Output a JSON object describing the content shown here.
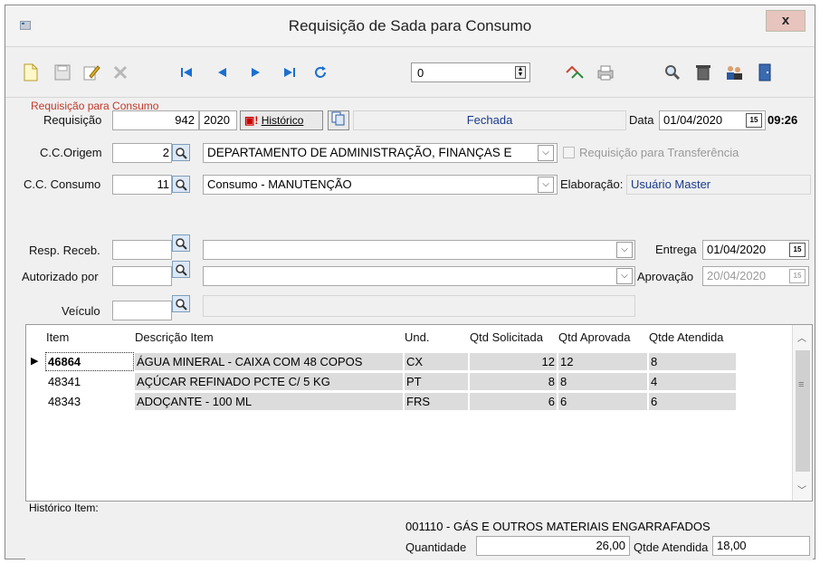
{
  "window": {
    "title": "Requisição de Sada para Consumo",
    "close": "x"
  },
  "toolbar": {
    "icons": [
      "new-document-icon",
      "save-icon",
      "edit-icon",
      "cancel-icon",
      "first-record-icon",
      "previous-record-icon",
      "next-record-icon",
      "last-record-icon",
      "refresh-icon",
      "transfer-icon",
      "print-icon",
      "search-icon",
      "delete-icon",
      "users-icon",
      "exit-icon"
    ],
    "record_value": "0"
  },
  "header": {
    "section_title": "Requisição para Consumo",
    "requisicao_label": "Requisição",
    "requisicao_number": "942",
    "requisicao_year": "2020",
    "historico_button": "Histórico",
    "status": "Fechada",
    "data_label": "Data",
    "data_value": "01/04/2020",
    "time": "09:26"
  },
  "cc_origem": {
    "label": "C.C.Origem",
    "code": "2",
    "value": "DEPARTAMENTO DE ADMINISTRAÇÃO, FINANÇAS E",
    "transfer_label": "Requisição para Transferência"
  },
  "cc_consumo": {
    "label": "C.C. Consumo",
    "code": "11",
    "value": "Consumo - MANUTENÇÃO",
    "elaboracao_label": "Elaboração:",
    "elaboracao_value": "Usuário Master"
  },
  "resp_receb": {
    "label": "Resp. Receb.",
    "entrega_label": "Entrega",
    "entrega_value": "01/04/2020"
  },
  "autorizado": {
    "label": "Autorizado por",
    "aprovacao_label": "Aprovação",
    "aprovacao_value": "20/04/2020"
  },
  "veiculo": {
    "label": "Veículo"
  },
  "grid": {
    "columns": [
      "Item",
      "Descrição Item",
      "Und.",
      "Qtd Solicitada",
      "Qtd Aprovada",
      "Qtde Atendida"
    ],
    "rows": [
      {
        "item": "46864",
        "descricao": "ÁGUA MINERAL - CAIXA COM 48 COPOS",
        "und": "CX",
        "solicitada": "12",
        "aprovada": "12",
        "atendida": "8",
        "selected": true
      },
      {
        "item": "48341",
        "descricao": "AÇÚCAR REFINADO PCTE C/ 5 KG",
        "und": "PT",
        "solicitada": "8",
        "aprovada": "8",
        "atendida": "4",
        "selected": false
      },
      {
        "item": "48343",
        "descricao": "ADOÇANTE - 100 ML",
        "und": "FRS",
        "solicitada": "6",
        "aprovada": "6",
        "atendida": "6",
        "selected": false
      }
    ]
  },
  "footer": {
    "historico_item_label": "Histórico Item:",
    "product": "001110 - GÁS E OUTROS MATERIAIS ENGARRAFADOS",
    "quantidade_label": "Quantidade",
    "quantidade_value": "26,00",
    "atendida_label": "Qtde Atendida",
    "atendida_value": "18,00"
  }
}
